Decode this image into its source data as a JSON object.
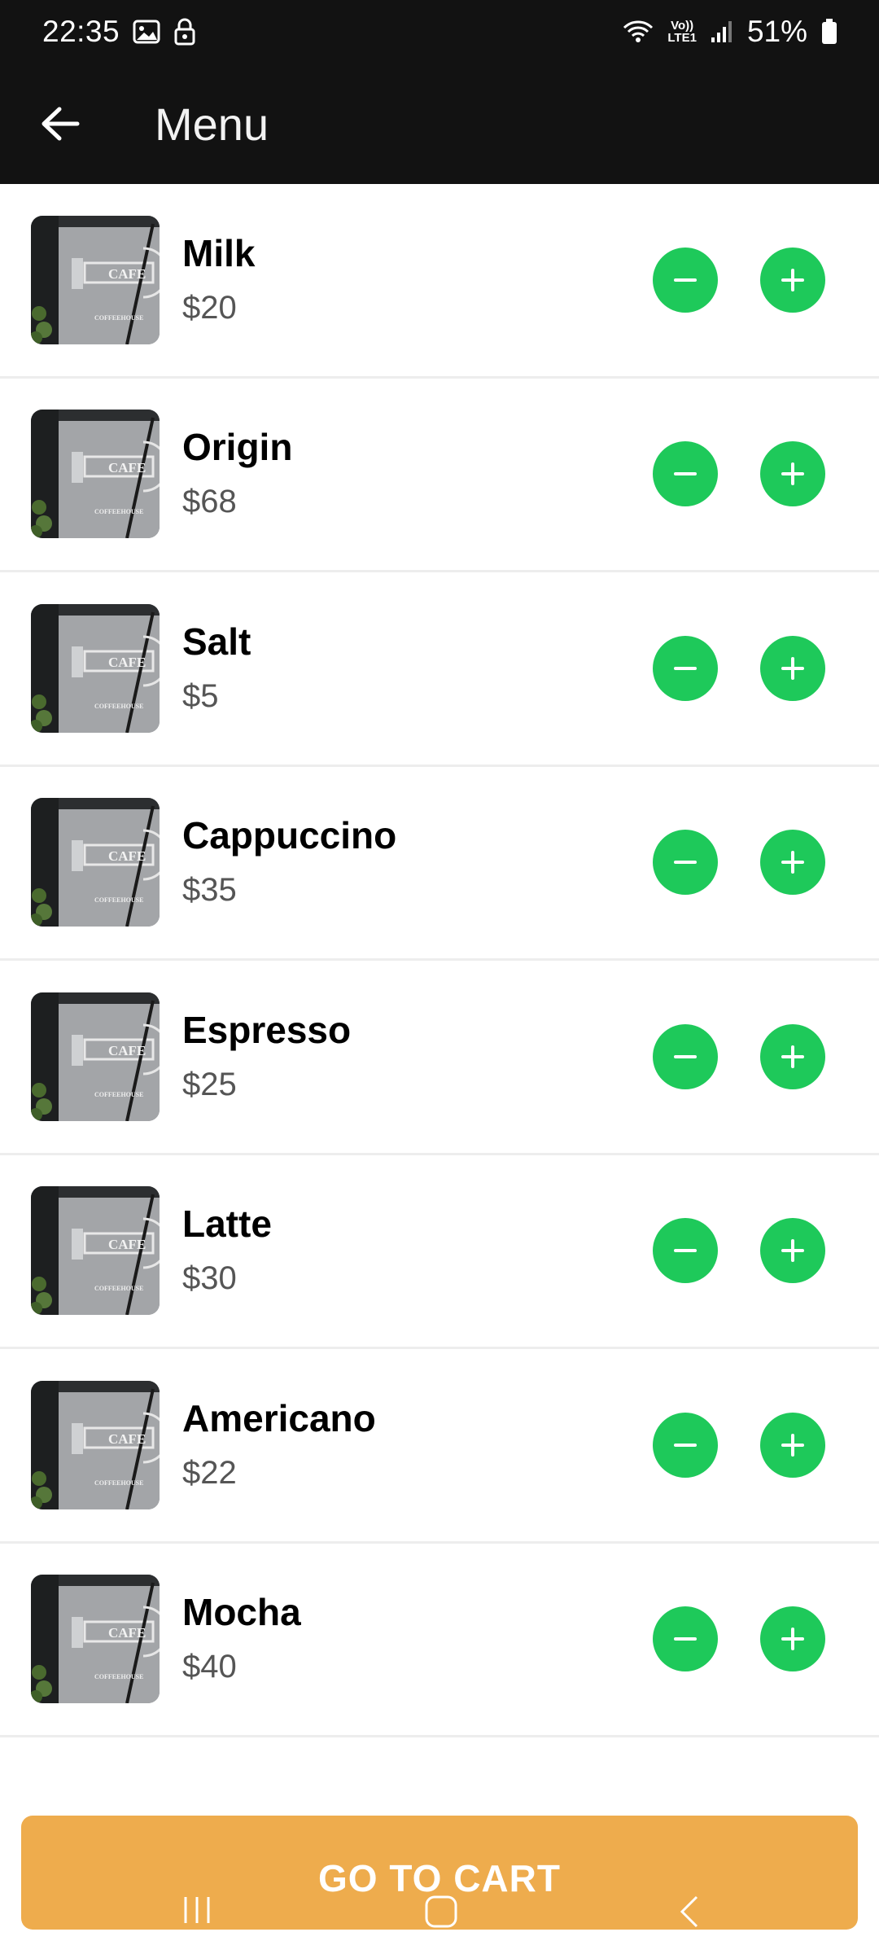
{
  "status_bar": {
    "time": "22:35",
    "volte_top": "Vo))",
    "volte_bottom": "LTE1",
    "battery_percent": "51%"
  },
  "app_bar": {
    "title": "Menu",
    "back_icon": "arrow-left-icon"
  },
  "menu_items": [
    {
      "name": "Milk",
      "price": "$20"
    },
    {
      "name": "Origin",
      "price": "$68"
    },
    {
      "name": "Salt",
      "price": "$5"
    },
    {
      "name": "Cappuccino",
      "price": "$35"
    },
    {
      "name": "Espresso",
      "price": "$25"
    },
    {
      "name": "Latte",
      "price": "$30"
    },
    {
      "name": "Americano",
      "price": "$22"
    },
    {
      "name": "Mocha",
      "price": "$40"
    }
  ],
  "thumbnail": {
    "sign_top": "CAFE",
    "sign_bottom": "COFFEEHOUSE"
  },
  "cart_button": {
    "label": "GO TO CART"
  },
  "colors": {
    "bar_background": "#121212",
    "accent_green": "#1ec95a",
    "cart_orange": "#eeac4d"
  }
}
